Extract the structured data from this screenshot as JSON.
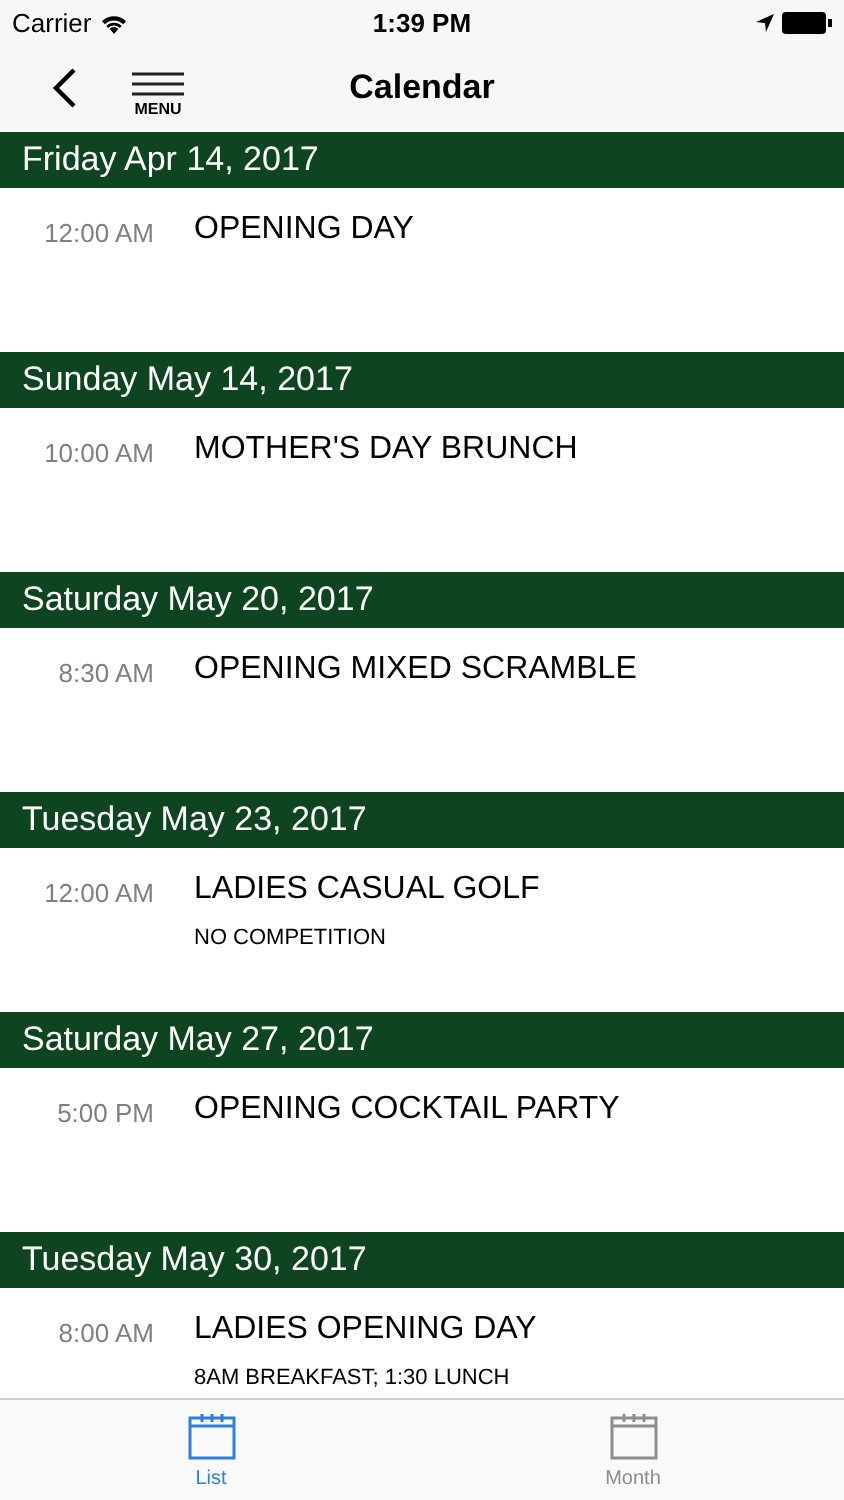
{
  "status_bar": {
    "carrier": "Carrier",
    "time": "1:39 PM"
  },
  "nav": {
    "menu_label": "MENU",
    "title": "Calendar"
  },
  "days": [
    {
      "date": "Friday Apr 14, 2017",
      "events": [
        {
          "time": "12:00 AM",
          "title": "OPENING DAY"
        }
      ]
    },
    {
      "date": "Sunday May 14, 2017",
      "events": [
        {
          "time": "10:00 AM",
          "title": "MOTHER'S DAY BRUNCH"
        }
      ]
    },
    {
      "date": "Saturday May 20, 2017",
      "events": [
        {
          "time": "8:30 AM",
          "title": "OPENING MIXED SCRAMBLE"
        }
      ]
    },
    {
      "date": "Tuesday May 23, 2017",
      "events": [
        {
          "time": "12:00 AM",
          "title": "LADIES CASUAL GOLF",
          "note": "NO COMPETITION"
        }
      ]
    },
    {
      "date": "Saturday May 27, 2017",
      "events": [
        {
          "time": "5:00 PM",
          "title": "OPENING COCKTAIL PARTY"
        }
      ]
    },
    {
      "date": "Tuesday May 30, 2017",
      "events": [
        {
          "time": "8:00 AM",
          "title": "LADIES OPENING DAY",
          "note": "8AM BREAKFAST; 1:30 LUNCH"
        }
      ]
    }
  ],
  "tabs": [
    {
      "label": "List",
      "selected": true
    },
    {
      "label": "Month",
      "selected": false
    }
  ]
}
